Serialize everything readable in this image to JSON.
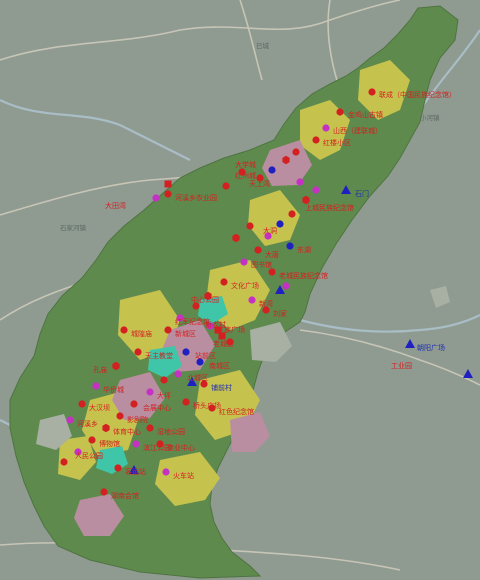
{
  "map": {
    "colors": {
      "background": "#8f9a90",
      "district": "#5f8a4e",
      "urban_yellow": "#c6c24e",
      "urban_pink": "#b98ea0",
      "urban_cyan": "#3fc6a8",
      "urban_grey": "#a7b0a2",
      "river": "#a9bdc6",
      "road": "#c7c5b6",
      "marker_red": "#d32020",
      "marker_purple": "#c531c5",
      "marker_blue": "#2020c0"
    },
    "base_labels": {
      "town_east": "已城",
      "town_west": "石家河镇",
      "town_east2": "小河镇"
    },
    "poi_labels": [
      "联成（中国民族纪念馆）",
      "金鸡山古镇",
      "山西（建联城）",
      "红楼小区",
      "大学城",
      "红州城",
      "天上湾",
      "上城民族纪念馆",
      "大洞",
      "大唐",
      "图书馆",
      "老城民族纪念馆",
      "文化广场",
      "中心公园",
      "红军纪念馆",
      "民族广场",
      "新城区",
      "老城区",
      "站前区",
      "南城区",
      "北城区",
      "大坪",
      "会展中心",
      "影剧院",
      "体育中心",
      "博物馆",
      "人民公园",
      "湿地公园",
      "滨江公园",
      "商业中心",
      "客运站",
      "火车站",
      "桥头广场",
      "红色纪念馆",
      "湖南会馆",
      "城隍庙",
      "天主教堂",
      "孔庙",
      "华侨城",
      "大汉坝",
      "河溪乡",
      "新湾",
      "刘家",
      "大田湾",
      "河溪乡农业园",
      "东湖",
      "铺前村",
      "石门",
      "朝阳广场",
      "工业园",
      "新农村"
    ]
  }
}
